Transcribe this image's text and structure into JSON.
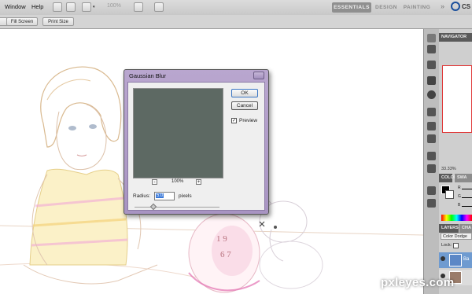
{
  "menu": {
    "window": "Window",
    "help": "Help"
  },
  "zoom": {
    "level": "100%"
  },
  "workspace": {
    "essentials": "ESSENTIALS",
    "design": "DESIGN",
    "painting": "PAINTING",
    "more": "»",
    "cs_live": "CS"
  },
  "options": {
    "fill_screen": "Fill Screen",
    "print_size": "Print Size"
  },
  "panels": {
    "navigator_tab": "NAVIGATOR",
    "navigator_zoom": "33.33%",
    "color_tab": "COLOR",
    "swatches_tab": "SWA",
    "color_channels": [
      "R",
      "G",
      "B"
    ],
    "layers_tab": "LAYERS",
    "channels_tab": "CHA",
    "blend_mode": "Color Dodge",
    "lock_label": "Lock:",
    "layer_label": "Ba"
  },
  "dialog": {
    "title": "Gaussian Blur",
    "ok_label": "OK",
    "cancel_label": "Cancel",
    "preview_label": "Preview",
    "preview_checked": true,
    "zoom_out": "-",
    "zoom_in": "+",
    "preview_zoom": "100%",
    "radius_label": "Radius:",
    "radius_value": "5.0",
    "radius_units": "pixels"
  },
  "watermark": "pxleyes.com",
  "colors": {
    "dialog_frame": "#b9a6cf",
    "workspace_active": "#8f8f8f",
    "preview_fill": "#5d6963"
  }
}
